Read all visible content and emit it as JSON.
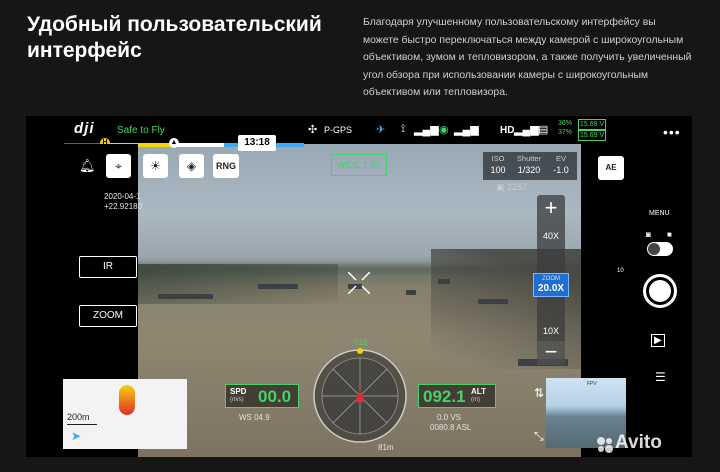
{
  "hero": {
    "title": "Удобный пользовательский интерфейс",
    "description": "Благодаря улучшенному пользовательскому интерфейсу вы можете быстро переключаться между камерой с широкоугольным объективом, зумом и тепловизором, а также получить увеличенный угол обзора при использовании камеры с широкоугольным объективом или тепловизора."
  },
  "topbar": {
    "logo": "dji",
    "status": "Safe to Fly",
    "time": "13:18",
    "gps_mode": "P-GPS",
    "link_label": "HD",
    "battery_pct_1": "36%",
    "battery_pct_2": "37%",
    "voltage_1": "15.69 V",
    "voltage_2": "15.69 V",
    "menu_icon": "more-dots-icon"
  },
  "left": {
    "coord_line1": "2020-04-1",
    "coord_line2": "+22.92180",
    "ir_label": "IR",
    "zoom_label": "ZOOM",
    "rng_label": "RNG",
    "map_scale": "200m"
  },
  "overlay": {
    "wide_label": "WIDE  1.0X",
    "iso_title": "ISO",
    "iso_value": "100",
    "shutter_title": "Shutter",
    "shutter_value": "1/320",
    "ev_title": "EV",
    "ev_value": "-1.0",
    "shots_left": "2257"
  },
  "zoom": {
    "plus": "+",
    "minus": "−",
    "level_40": "40X",
    "level_10": "10X",
    "current_title": "ZOOM",
    "current_value": "20.0X",
    "slider_mark": "10"
  },
  "hud": {
    "spd_label": "SPD",
    "spd_unit": "(m/s)",
    "spd_value": "00.0",
    "ws": "WS 04.9",
    "alt_label": "ALT",
    "alt_unit": "(m)",
    "alt_value": "092.1",
    "vs": "0.0  VS",
    "asl": "0080.8 ASL",
    "heading": "016",
    "distance": "81m"
  },
  "right": {
    "ae_label": "AE",
    "menu_label": "MENU",
    "fpv_label": "FPV"
  },
  "watermark": "Avito"
}
